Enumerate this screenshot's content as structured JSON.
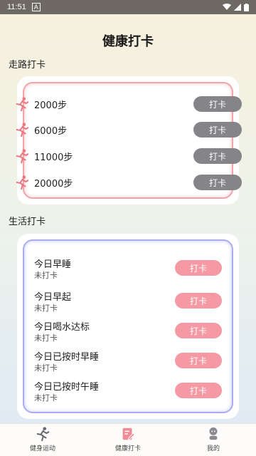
{
  "status_bar": {
    "time": "11:51",
    "notification_icon": "A",
    "wifi_icon": "wifi-icon",
    "signal_icon": "signal-icon",
    "battery_icon": "battery-icon"
  },
  "page": {
    "title": "健康打卡"
  },
  "walk_section": {
    "title": "走路打卡",
    "items": [
      {
        "label": "2000步",
        "button": "打卡"
      },
      {
        "label": "6000步",
        "button": "打卡"
      },
      {
        "label": "11000步",
        "button": "打卡"
      },
      {
        "label": "20000步",
        "button": "打卡"
      }
    ]
  },
  "life_section": {
    "title": "生活打卡",
    "items": [
      {
        "name": "今日早睡",
        "status": "未打卡",
        "button": "打卡"
      },
      {
        "name": "今日早起",
        "status": "未打卡",
        "button": "打卡"
      },
      {
        "name": "今日喝水达标",
        "status": "未打卡",
        "button": "打卡"
      },
      {
        "name": "今日已按时早睡",
        "status": "未打卡",
        "button": "打卡"
      },
      {
        "name": "今日已按时午睡",
        "status": "未打卡",
        "button": "打卡"
      }
    ]
  },
  "tabbar": {
    "tabs": [
      {
        "label": "健身运动",
        "icon": "runner-icon"
      },
      {
        "label": "健康打卡",
        "icon": "checkin-icon",
        "active": true
      },
      {
        "label": "我的",
        "icon": "profile-icon"
      }
    ]
  },
  "colors": {
    "walk_border": "#f3a3aa",
    "life_border": "#a9acf0",
    "gray_button": "#858589",
    "pink_button": "#f59aa5",
    "runner": "#e9777f",
    "active_tab": "#f08a95"
  }
}
